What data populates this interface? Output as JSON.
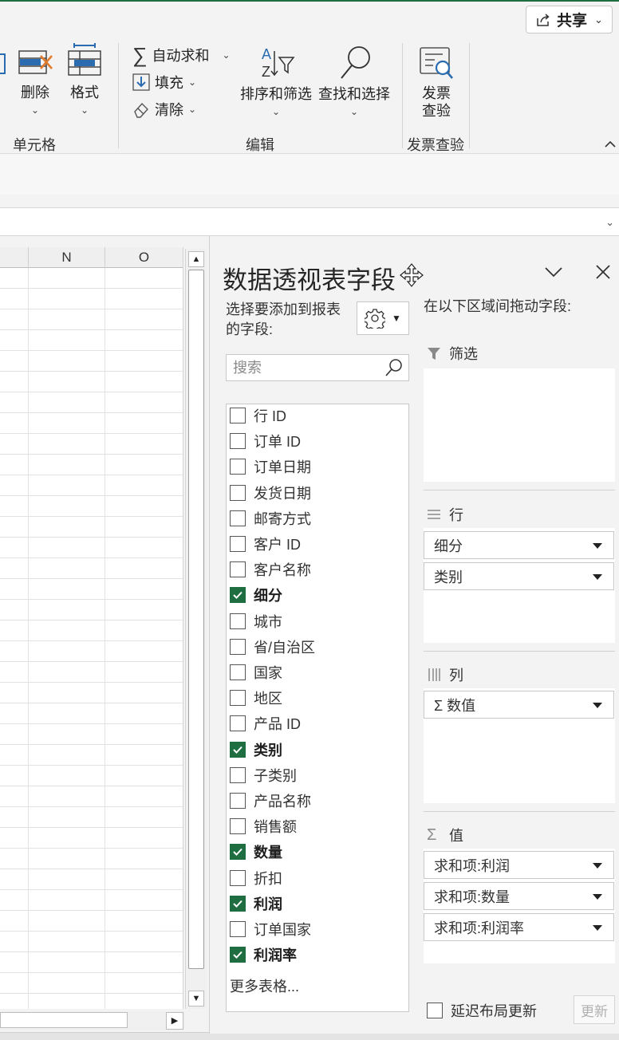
{
  "ribbon": {
    "share_label": "共享",
    "cells_group": {
      "delete_label": "删除",
      "format_label": "格式",
      "group_label": "单元格"
    },
    "edit_group": {
      "autosum_label": "自动求和",
      "fill_label": "填充",
      "clear_label": "清除",
      "sort_filter_label": "排序和筛选",
      "find_select_label": "查找和选择",
      "group_label": "编辑"
    },
    "invoice_group": {
      "check_label_1": "发票",
      "check_label_2": "查验",
      "group_label": "发票查验"
    }
  },
  "sheet": {
    "columns": [
      "N",
      "O"
    ]
  },
  "pivot_pane": {
    "title": "数据透视表字段",
    "pick_fields_label": "选择要添加到报表的字段:",
    "search_placeholder": "搜索",
    "fields": [
      {
        "label": "行 ID",
        "checked": false
      },
      {
        "label": "订单 ID",
        "checked": false
      },
      {
        "label": "订单日期",
        "checked": false
      },
      {
        "label": "发货日期",
        "checked": false
      },
      {
        "label": "邮寄方式",
        "checked": false
      },
      {
        "label": "客户 ID",
        "checked": false
      },
      {
        "label": "客户名称",
        "checked": false
      },
      {
        "label": "细分",
        "checked": true
      },
      {
        "label": "城市",
        "checked": false
      },
      {
        "label": "省/自治区",
        "checked": false
      },
      {
        "label": "国家",
        "checked": false
      },
      {
        "label": "地区",
        "checked": false
      },
      {
        "label": "产品 ID",
        "checked": false
      },
      {
        "label": "类别",
        "checked": true
      },
      {
        "label": "子类别",
        "checked": false
      },
      {
        "label": "产品名称",
        "checked": false
      },
      {
        "label": "销售额",
        "checked": false
      },
      {
        "label": "数量",
        "checked": true
      },
      {
        "label": "折扣",
        "checked": false
      },
      {
        "label": "利润",
        "checked": true
      },
      {
        "label": "订单国家",
        "checked": false
      },
      {
        "label": "利润率",
        "checked": true
      }
    ],
    "more_tables_label": "更多表格...",
    "drag_label": "在以下区域间拖动字段:",
    "areas": {
      "filter": {
        "label": "筛选",
        "items": []
      },
      "rows": {
        "label": "行",
        "items": [
          "细分",
          "类别"
        ]
      },
      "columns": {
        "label": "列",
        "items": [
          "Σ 数值"
        ]
      },
      "values": {
        "label": "值",
        "items": [
          "求和项:利润",
          "求和项:数量",
          "求和项:利润率"
        ]
      }
    },
    "defer_label": "延迟布局更新",
    "update_label": "更新"
  },
  "colors": {
    "accent": "#1e6e41",
    "ribbon_icon_blue": "#2b6cb0",
    "ribbon_icon_orange": "#e07a2c"
  }
}
